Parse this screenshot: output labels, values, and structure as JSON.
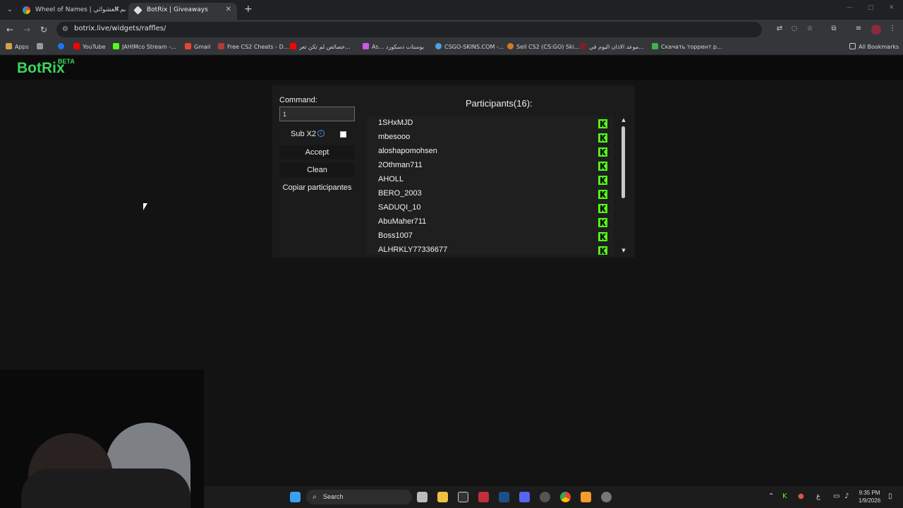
{
  "browser": {
    "tabs": [
      {
        "title": "Wheel of Names | اسم العشوائي"
      },
      {
        "title": "BotRix | Giveaways"
      }
    ],
    "url": "botrix.live/widgets/raffles/",
    "bookmarks": [
      {
        "label": "Apps",
        "color": "#d5a24a"
      },
      {
        "label": "YouTube",
        "color": "#ff0000"
      },
      {
        "label": "JAHIMco Stream -...",
        "color": "#53fc18"
      },
      {
        "label": "Gmail",
        "color": "#ea4335"
      },
      {
        "label": "Free CS2 Cheats - D...",
        "color": "#b33a3a"
      },
      {
        "label": "خصائص لم تكن تعر...",
        "color": "#ff0000"
      },
      {
        "label": "As... بوستات دسكورد",
        "color": "#c85be3"
      },
      {
        "label": "CSGO-SKINS.COM -...",
        "color": "#4aa3df"
      },
      {
        "label": "Sell CS2 (CS:GO) Ski...",
        "color": "#d07a2e"
      },
      {
        "label": "موعد الاذان اليوم في...",
        "color": "#7a1f2b"
      },
      {
        "label": "Скачать торрент р...",
        "color": "#3bb54a"
      },
      {
        "label": "All Bookmarks",
        "color": "#cccccc"
      }
    ]
  },
  "app": {
    "logo": "BotRix",
    "logo_badge": "BETA",
    "accent_color": "#3ed65a"
  },
  "raffle": {
    "command_label": "Command:",
    "command_value": "1",
    "sub_x2_label": "Sub X2",
    "sub_x2_checked": false,
    "accept_label": "Accept",
    "clean_label": "Clean",
    "copy_label": "Copiar participantes",
    "participants_title": "Participants(16):",
    "participants": [
      {
        "name": "1SHxMJD",
        "platform": "kick-icon"
      },
      {
        "name": "mbesooo",
        "platform": "kick-icon"
      },
      {
        "name": "aloshapomohsen",
        "platform": "kick-icon"
      },
      {
        "name": "2Othman711",
        "platform": "kick-icon"
      },
      {
        "name": "AHOLL",
        "platform": "kick-icon"
      },
      {
        "name": "BERO_2003",
        "platform": "kick-icon"
      },
      {
        "name": "SADUQI_10",
        "platform": "kick-icon"
      },
      {
        "name": "AbuMaher711",
        "platform": "kick-icon"
      },
      {
        "name": "Boss1007",
        "platform": "kick-icon"
      },
      {
        "name": "ALHRKLY77336677",
        "platform": "kick-icon"
      }
    ]
  },
  "taskbar": {
    "search_label": "Search",
    "time": "9:35 PM",
    "date": "1/9/2026",
    "lang": "ع"
  }
}
